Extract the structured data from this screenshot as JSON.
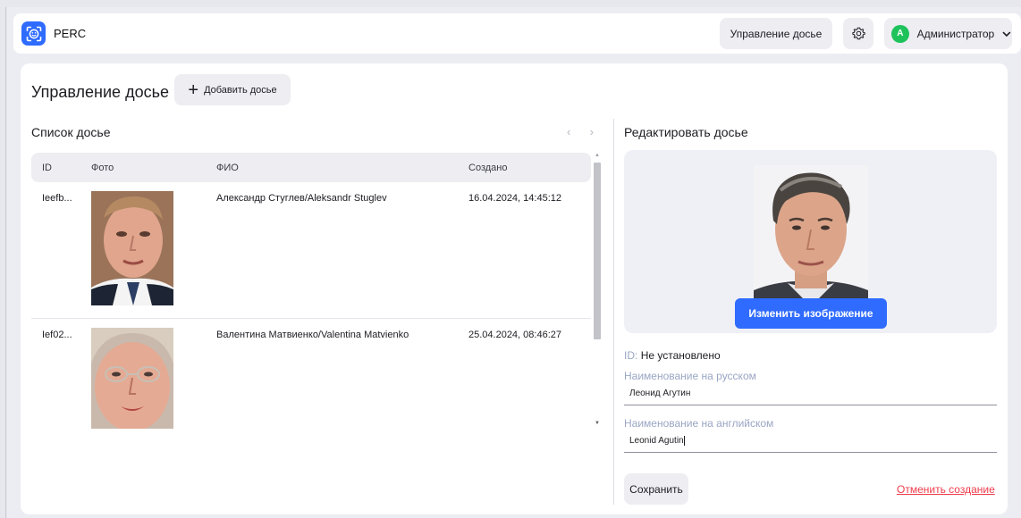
{
  "header": {
    "app_title": "PERC",
    "manage_button": "Управление досье",
    "user": {
      "initial": "A",
      "name": "Администратор"
    }
  },
  "page": {
    "title": "Управление досье",
    "add_button": "Добавить досье"
  },
  "list": {
    "title": "Список досье",
    "columns": [
      "ID",
      "Фото",
      "ФИО",
      "Создано"
    ],
    "rows": [
      {
        "id": "Ieefb...",
        "name": "Александр Стуглев/Aleksandr Stuglev",
        "created": "16.04.2024, 14:45:12"
      },
      {
        "id": "Ief02...",
        "name": "Валентина Матвиенко/Valentina Matvienko",
        "created": "25.04.2024, 08:46:27"
      }
    ]
  },
  "edit": {
    "title": "Редактировать досье",
    "change_image_button": "Изменить изображение",
    "id_label": "ID:",
    "id_value": "Не установлено",
    "name_ru_label": "Наименование на русском",
    "name_ru_value": "Леонид Агутин",
    "name_en_label": "Наименование на английском",
    "name_en_value": "Leonid Agutin",
    "save_button": "Сохранить",
    "cancel_link": "Отменить создание"
  },
  "colors": {
    "accent": "#2f6bff",
    "danger": "#ee3c4b",
    "avatar": "#1ec25b",
    "label": "#9aa6c4"
  }
}
